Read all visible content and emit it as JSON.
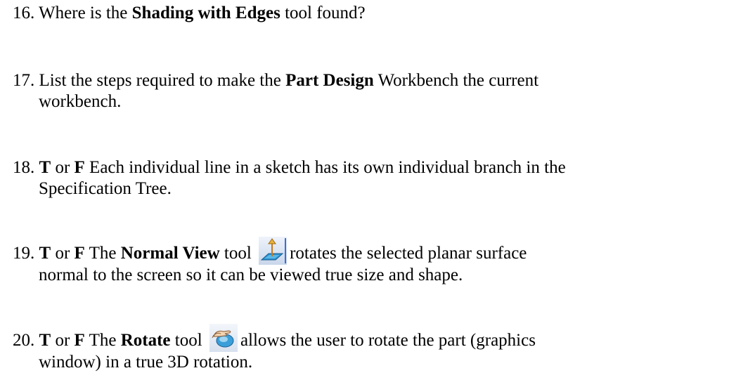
{
  "questions": [
    {
      "lines": [
        {
          "num": "16.",
          "parts": [
            " Where is the ",
            "Shading with Edges",
            " tool found?"
          ]
        }
      ]
    },
    {
      "lines": [
        {
          "num": "17.",
          "parts": [
            " List the steps required to make the ",
            "Part Design",
            " Workbench the current"
          ]
        },
        {
          "text": "workbench."
        }
      ]
    },
    {
      "lines": [
        {
          "num": "18.",
          "parts": [
            " ",
            "T",
            " or ",
            "F",
            "  Each individual line in a sketch has its own individual branch in the"
          ]
        },
        {
          "text": "Specification Tree."
        }
      ]
    },
    {
      "lines": [
        {
          "num": "19.",
          "parts": [
            " ",
            "T",
            " or ",
            "F",
            "  The ",
            "Normal View",
            " tool ",
            "rotates the selected planar surface"
          ]
        },
        {
          "text": "normal to the screen so it can be viewed true size and shape."
        }
      ],
      "icon": "normal-view-icon"
    },
    {
      "lines": [
        {
          "num": "20.",
          "parts": [
            " ",
            "T",
            " or ",
            "F",
            "  The ",
            "Rotate",
            " tool ",
            "allows the user to rotate the part (graphics"
          ]
        },
        {
          "text": "window) in a true 3D rotation."
        }
      ],
      "icon": "rotate-icon"
    }
  ]
}
